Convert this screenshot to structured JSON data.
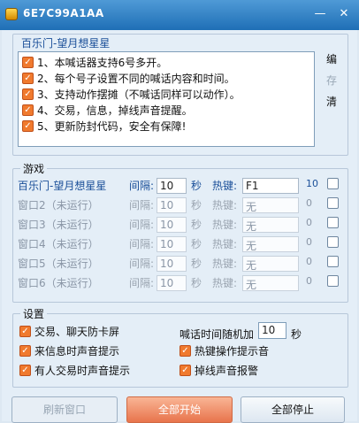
{
  "window": {
    "title": "6E7C99A1AA",
    "minimize": "—",
    "close": "✕"
  },
  "shout_panel": {
    "game_name": "百乐门-望月想星星",
    "items": [
      "1、本喊话器支持6号多开。",
      "2、每个号子设置不同的喊话内容和时间。",
      "3、支持动作摆摊（不喊话同样可以动作）。",
      "4、交易，信息，掉线声音提醒。",
      "5、更新防封代码，安全有保障!"
    ],
    "side_buttons": {
      "edit": "编",
      "save": "存",
      "clear": "清"
    }
  },
  "game_group": {
    "legend": "游戏",
    "interval_label": "间隔:",
    "seconds_label": "秒",
    "hotkey_label": "热键:",
    "rows": [
      {
        "name": "百乐门-望月想星星",
        "interval": "10",
        "hotkey": "F1",
        "count": "10"
      },
      {
        "name": "窗口2（未运行）",
        "interval": "10",
        "hotkey": "无",
        "count": "0"
      },
      {
        "name": "窗口3（未运行）",
        "interval": "10",
        "hotkey": "无",
        "count": "0"
      },
      {
        "name": "窗口4（未运行）",
        "interval": "10",
        "hotkey": "无",
        "count": "0"
      },
      {
        "name": "窗口5（未运行）",
        "interval": "10",
        "hotkey": "无",
        "count": "0"
      },
      {
        "name": "窗口6（未运行）",
        "interval": "10",
        "hotkey": "无",
        "count": "0"
      }
    ]
  },
  "settings": {
    "legend": "设置",
    "trade_chat_anti_lag": "交易、聊天防卡屏",
    "random_interval_label": "喊话时间随机加",
    "random_interval_value": "10",
    "seconds_label": "秒",
    "message_sound": "来信息时声音提示",
    "hotkey_sound": "热键操作提示音",
    "trade_sound": "有人交易时声音提示",
    "disconnect_alarm": "掉线声音报警"
  },
  "buttons": {
    "refresh": "刷新窗口",
    "start_all": "全部开始",
    "stop_all": "全部停止"
  },
  "colors": {
    "accent": "#1f6fb6",
    "checkbox": "#f07a2e",
    "link_text": "#1a4f99"
  }
}
